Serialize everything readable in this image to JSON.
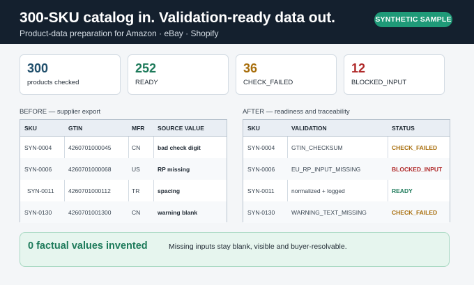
{
  "header": {
    "title": "300-SKU catalog in. Validation-ready data out.",
    "subtitle": "Product-data preparation for Amazon · eBay · Shopify",
    "badge": "SYNTHETIC SAMPLE"
  },
  "stats": [
    {
      "value": "300",
      "label": "products checked",
      "color": "#1f4e6b"
    },
    {
      "value": "252",
      "label": "READY",
      "color": "#1d7a5a"
    },
    {
      "value": "36",
      "label": "CHECK_FAILED",
      "color": "#a86e0c"
    },
    {
      "value": "12",
      "label": "BLOCKED_INPUT",
      "color": "#b02a2a"
    }
  ],
  "before": {
    "label": "BEFORE — supplier export",
    "headers": [
      "SKU",
      "GTIN",
      "MFR",
      "SOURCE VALUE"
    ],
    "rows": [
      [
        "SYN-0004",
        "4260701000045",
        "CN",
        "bad check digit"
      ],
      [
        "SYN-0006",
        "4260701000068",
        "US",
        "RP missing"
      ],
      [
        "SYN-0011",
        "4260701000112",
        "TR",
        "spacing"
      ],
      [
        "SYN-0130",
        "4260701001300",
        "CN",
        "warning blank"
      ]
    ]
  },
  "after": {
    "label": "AFTER — readiness and traceability",
    "headers": [
      "SKU",
      "VALIDATION",
      "STATUS"
    ],
    "rows": [
      [
        "SYN-0004",
        "GTIN_CHECKSUM",
        "CHECK_FAILED"
      ],
      [
        "SYN-0006",
        "EU_RP_INPUT_MISSING",
        "BLOCKED_INPUT"
      ],
      [
        "SYN-0011",
        "normalized + logged",
        "READY"
      ],
      [
        "SYN-0130",
        "WARNING_TEXT_MISSING",
        "CHECK_FAILED"
      ]
    ]
  },
  "footer": {
    "headline": "0 factual values invented",
    "note": "Missing inputs stay blank, visible and buyer-resolvable."
  }
}
